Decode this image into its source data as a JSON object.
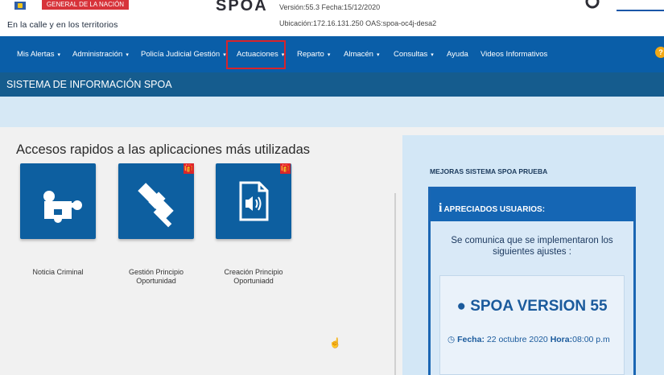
{
  "header": {
    "entity_name": "GENERAL DE LA NACIÓN",
    "tagline": "En la calle y en los territorios",
    "app_logo": "SPOA",
    "version_line": "Versión:55.3  Fecha:15/12/2020",
    "location_line": "Ubicación:172.16.131.250  OAS:spoa-oc4j-desa2"
  },
  "nav": {
    "items": [
      {
        "label": "Mis Alertas",
        "caret": "▾"
      },
      {
        "label": "Administración",
        "caret": "▾"
      },
      {
        "label": "Policía Judicial Gestión",
        "caret": "▾"
      },
      {
        "label": "Actuaciones",
        "caret": "▾"
      },
      {
        "label": "Reparto",
        "caret": "▾"
      },
      {
        "label": "Almacén",
        "caret": "▾"
      },
      {
        "label": "Consultas",
        "caret": "▾"
      },
      {
        "label": "Ayuda",
        "caret": ""
      },
      {
        "label": "Videos Informativos",
        "caret": ""
      }
    ],
    "highlighted_item": "Actuaciones",
    "help_icon": "?"
  },
  "title_bar": {
    "text": "SISTEMA DE INFORMACIÓN SPOA"
  },
  "main": {
    "section_title": "Accesos rapidos a las aplicaciones más utilizadas",
    "tiles": [
      {
        "label": "Noticia Criminal",
        "icon": "puzzle-icon",
        "badge": ""
      },
      {
        "label": "Gestión Principio Oportunidad",
        "icon": "gavel-icon",
        "badge": "🎁"
      },
      {
        "label": "Creación Principio Oportuniadd",
        "icon": "audio-file-icon",
        "badge": "🎁"
      }
    ]
  },
  "right_panel": {
    "heading": "MEJORAS SISTEMA SPOA PRUEBA",
    "notice_title": "APRECIADOS USUARIOS:",
    "notice_message": "Se comunica que se implementaron los siguientes ajustes :",
    "version_title": "SPOA VERSION 55",
    "date_label": "Fecha:",
    "date_value": "22 octubre 2020",
    "time_label": "Hora:",
    "time_value": "08:00 p.m"
  },
  "colors": {
    "nav_bg": "#0a5ea8",
    "title_bar_bg": "#155c8e",
    "tile_bg": "#0d5fa0",
    "highlight_border": "#d8232a",
    "notice_header_bg": "#1566b4"
  }
}
